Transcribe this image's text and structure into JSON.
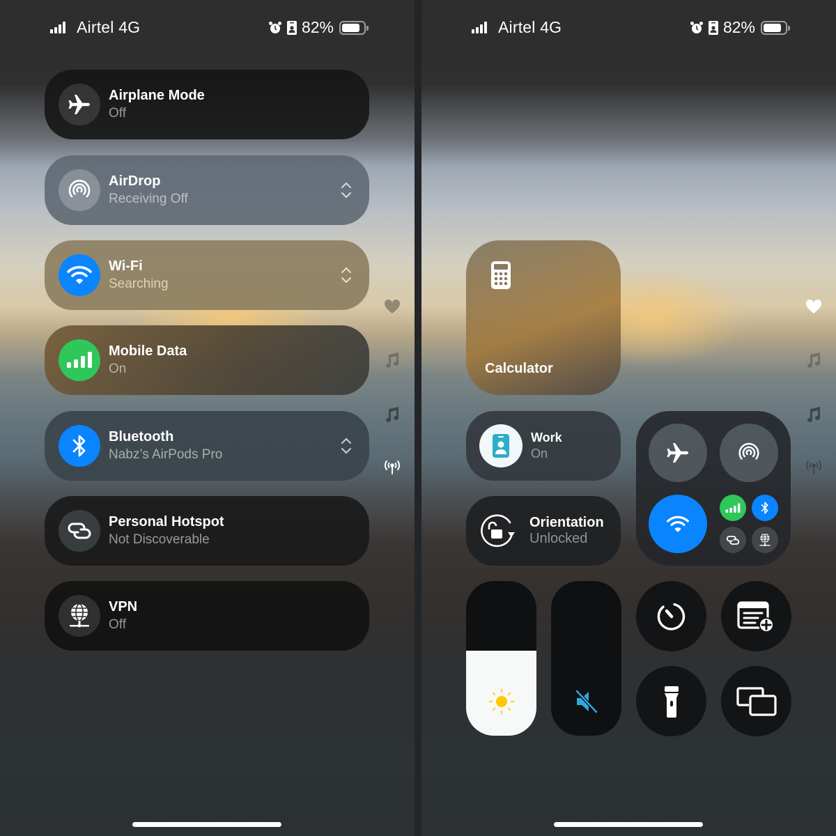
{
  "status_bar": {
    "carrier": "Airtel 4G",
    "battery_percent": "82%",
    "battery_level": 0.82,
    "icons": [
      "cellular-signal-icon",
      "alarm-icon",
      "work-focus-icon",
      "battery-icon"
    ]
  },
  "left_screen": {
    "rows": [
      {
        "id": "airplane",
        "title": "Airplane Mode",
        "subtitle": "Off",
        "icon": "airplane-icon",
        "has_chevron": false
      },
      {
        "id": "airdrop",
        "title": "AirDrop",
        "subtitle": "Receiving Off",
        "icon": "airdrop-icon",
        "has_chevron": true
      },
      {
        "id": "wifi",
        "title": "Wi-Fi",
        "subtitle": "Searching",
        "icon": "wifi-icon",
        "has_chevron": true
      },
      {
        "id": "mobile-data",
        "title": "Mobile Data",
        "subtitle": "On",
        "icon": "cellular-icon",
        "has_chevron": false
      },
      {
        "id": "bluetooth",
        "title": "Bluetooth",
        "subtitle": "Nabz’s AirPods Pro",
        "icon": "bluetooth-icon",
        "has_chevron": true
      },
      {
        "id": "hotspot",
        "title": "Personal Hotspot",
        "subtitle": "Not Discoverable",
        "icon": "hotspot-icon",
        "has_chevron": false
      },
      {
        "id": "vpn",
        "title": "VPN",
        "subtitle": "Off",
        "icon": "vpn-globe-icon",
        "has_chevron": false
      }
    ],
    "page_indicators": [
      "heart-icon",
      "music-note-icon",
      "music-note-icon",
      "antenna-icon"
    ],
    "active_page": "antenna"
  },
  "right_screen": {
    "calculator": {
      "label": "Calculator",
      "icon": "calculator-icon"
    },
    "focus": {
      "title": "Work",
      "subtitle": "On",
      "icon": "work-focus-icon"
    },
    "orientation": {
      "title": "Orientation",
      "subtitle": "Unlocked",
      "icon": "orientation-lock-icon"
    },
    "connectivity": {
      "airplane": "off",
      "airdrop": "off",
      "wifi": "on",
      "mobile_data": "on",
      "bluetooth": "on",
      "hotspot": "off",
      "vpn": "off"
    },
    "brightness_level": 0.55,
    "volume_level": 0.0,
    "volume_muted": true,
    "buttons": [
      "timer-icon",
      "quick-note-icon",
      "flashlight-icon",
      "screen-mirroring-icon"
    ],
    "page_indicators": [
      "heart-icon",
      "music-note-icon",
      "music-note-icon",
      "antenna-icon"
    ],
    "active_page": "heart"
  },
  "colors": {
    "blue": "#0a84ff",
    "green": "#30c75a",
    "sun": "#ffc800",
    "mute": "#32a8e0",
    "work_icon": "#2eadc8"
  }
}
